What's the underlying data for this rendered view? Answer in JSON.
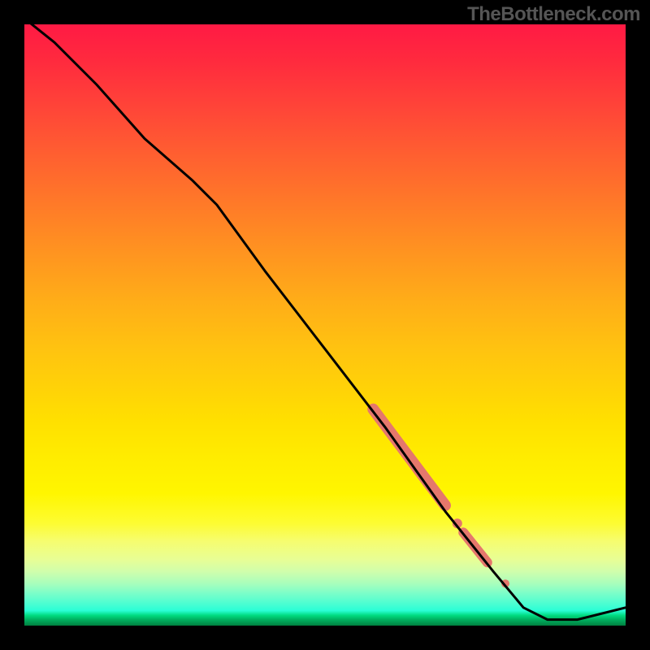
{
  "watermark": "TheBottleneck.com",
  "chart_data": {
    "type": "line",
    "title": "",
    "xlabel": "",
    "ylabel": "",
    "xlim": [
      0,
      100
    ],
    "ylim": [
      0,
      100
    ],
    "grid": false,
    "legend": false,
    "series": [
      {
        "name": "curve",
        "stroke": "#000000",
        "stroke_width": 3,
        "x": [
          0,
          5,
          12,
          20,
          28,
          32,
          40,
          50,
          60,
          70,
          78,
          83,
          87,
          92,
          100
        ],
        "y": [
          101,
          97,
          90,
          81,
          74,
          70,
          59,
          46,
          33,
          19,
          9,
          3,
          1,
          1,
          3
        ]
      }
    ],
    "highlights": [
      {
        "name": "highlight-segment-1",
        "color": "#e5776c",
        "type": "thick-segment",
        "width": 14,
        "x": [
          58,
          70
        ],
        "y": [
          36,
          20
        ]
      },
      {
        "name": "highlight-dot-1",
        "color": "#e5776c",
        "type": "dot",
        "radius": 6,
        "x": 72,
        "y": 17
      },
      {
        "name": "highlight-segment-2",
        "color": "#e5776c",
        "type": "thick-segment",
        "width": 12,
        "x": [
          73,
          77
        ],
        "y": [
          15.5,
          10.5
        ]
      },
      {
        "name": "highlight-dot-2",
        "color": "#e5776c",
        "type": "dot",
        "radius": 5,
        "x": 80,
        "y": 7
      }
    ],
    "gradient_background": {
      "top_color": "#ff1a44",
      "mid_color": "#ffe000",
      "bottom_color": "#00b060"
    }
  }
}
